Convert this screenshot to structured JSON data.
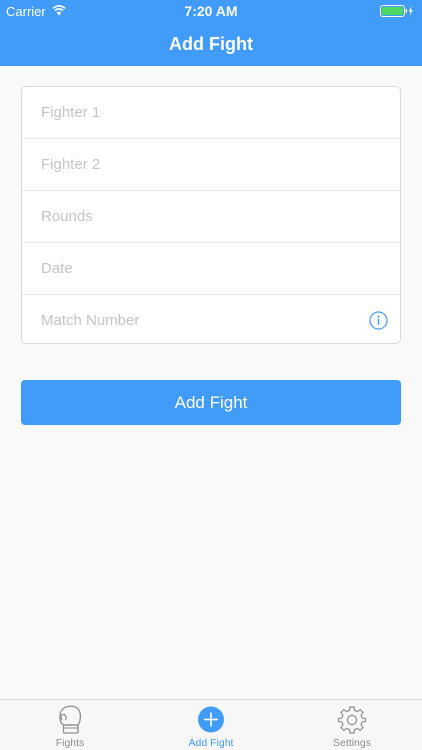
{
  "status_bar": {
    "carrier": "Carrier",
    "time": "7:20 AM",
    "wifi_icon": "wifi-icon",
    "battery_icon": "battery-charging-icon",
    "battery_color": "#4cd964"
  },
  "header": {
    "title": "Add Fight",
    "background": "#419bf9"
  },
  "form": {
    "fields": [
      {
        "placeholder": "Fighter 1",
        "value": ""
      },
      {
        "placeholder": "Fighter 2",
        "value": ""
      },
      {
        "placeholder": "Rounds",
        "value": ""
      },
      {
        "placeholder": "Date",
        "value": ""
      },
      {
        "placeholder": "Match Number",
        "value": "",
        "icon": "info-icon"
      }
    ]
  },
  "add_button": {
    "label": "Add Fight",
    "color": "#419bf9"
  },
  "tab_bar": {
    "tabs": [
      {
        "label": "Fights",
        "icon": "boxing-glove-icon",
        "active": false
      },
      {
        "label": "Add Fight",
        "icon": "plus-circle-icon",
        "active": true
      },
      {
        "label": "Settings",
        "icon": "gear-icon",
        "active": false
      }
    ],
    "active_color": "#419bf9",
    "inactive_color": "#8e8e93"
  }
}
